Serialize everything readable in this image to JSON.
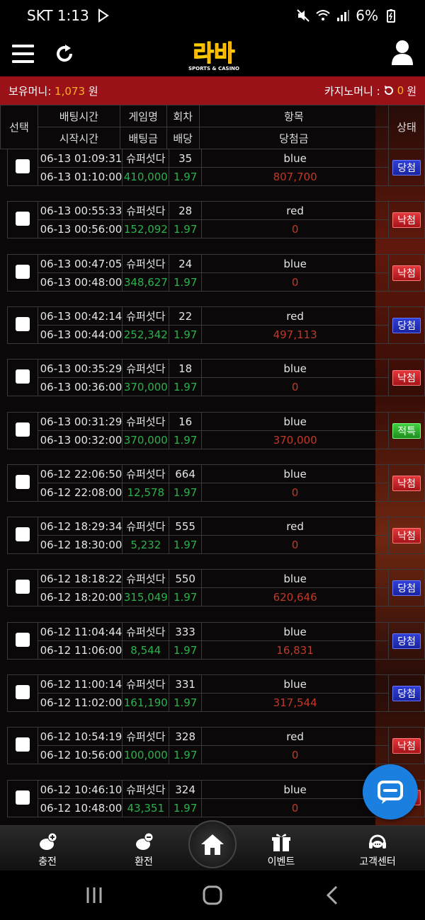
{
  "status_bar": {
    "carrier_time": "SKT 1:13",
    "battery": "6%"
  },
  "header": {
    "logo_text": "라바",
    "logo_sub": "SPORTS & CASINO"
  },
  "balance": {
    "label": "보유머니:",
    "value": "1,073",
    "unit": "원",
    "casino_label": "카지노머니 :",
    "casino_value": "0",
    "casino_unit": "원"
  },
  "table": {
    "headers": {
      "select": "선택",
      "bet_time": "배팅시간",
      "start_time": "시작시간",
      "game": "게임명",
      "bet_amount": "배팅금",
      "round": "회차",
      "odds": "배당",
      "item": "항목",
      "payout": "당첨금",
      "status": "상태"
    },
    "rows": [
      {
        "bet_time": "06-13 01:09:31",
        "start_time": "06-13 01:10:00",
        "game": "슈퍼섯다",
        "amount": "410,000",
        "round": "35",
        "odds": "1.97",
        "item": "blue",
        "payout": "807,700",
        "status": "당첨",
        "status_type": "win"
      },
      {
        "bet_time": "06-13 00:55:33",
        "start_time": "06-13 00:56:00",
        "game": "슈퍼섯다",
        "amount": "152,092",
        "round": "28",
        "odds": "1.97",
        "item": "red",
        "payout": "0",
        "status": "낙첨",
        "status_type": "lose"
      },
      {
        "bet_time": "06-13 00:47:05",
        "start_time": "06-13 00:48:00",
        "game": "슈퍼섯다",
        "amount": "348,627",
        "round": "24",
        "odds": "1.97",
        "item": "blue",
        "payout": "0",
        "status": "낙첨",
        "status_type": "lose"
      },
      {
        "bet_time": "06-13 00:42:14",
        "start_time": "06-13 00:44:00",
        "game": "슈퍼섯다",
        "amount": "252,342",
        "round": "22",
        "odds": "1.97",
        "item": "red",
        "payout": "497,113",
        "status": "당첨",
        "status_type": "win"
      },
      {
        "bet_time": "06-13 00:35:29",
        "start_time": "06-13 00:36:00",
        "game": "슈퍼섯다",
        "amount": "370,000",
        "round": "18",
        "odds": "1.97",
        "item": "blue",
        "payout": "0",
        "status": "낙첨",
        "status_type": "lose"
      },
      {
        "bet_time": "06-13 00:31:29",
        "start_time": "06-13 00:32:00",
        "game": "슈퍼섯다",
        "amount": "370,000",
        "round": "16",
        "odds": "1.97",
        "item": "blue",
        "payout": "370,000",
        "status": "적특",
        "status_type": "refund"
      },
      {
        "bet_time": "06-12 22:06:50",
        "start_time": "06-12 22:08:00",
        "game": "슈퍼섯다",
        "amount": "12,578",
        "round": "664",
        "odds": "1.97",
        "item": "blue",
        "payout": "0",
        "status": "낙첨",
        "status_type": "lose"
      },
      {
        "bet_time": "06-12 18:29:34",
        "start_time": "06-12 18:30:00",
        "game": "슈퍼섯다",
        "amount": "5,232",
        "round": "555",
        "odds": "1.97",
        "item": "red",
        "payout": "0",
        "status": "낙첨",
        "status_type": "lose"
      },
      {
        "bet_time": "06-12 18:18:22",
        "start_time": "06-12 18:20:00",
        "game": "슈퍼섯다",
        "amount": "315,049",
        "round": "550",
        "odds": "1.97",
        "item": "blue",
        "payout": "620,646",
        "status": "당첨",
        "status_type": "win"
      },
      {
        "bet_time": "06-12 11:04:44",
        "start_time": "06-12 11:06:00",
        "game": "슈퍼섯다",
        "amount": "8,544",
        "round": "333",
        "odds": "1.97",
        "item": "blue",
        "payout": "16,831",
        "status": "당첨",
        "status_type": "win"
      },
      {
        "bet_time": "06-12 11:00:14",
        "start_time": "06-12 11:02:00",
        "game": "슈퍼섯다",
        "amount": "161,190",
        "round": "331",
        "odds": "1.97",
        "item": "blue",
        "payout": "317,544",
        "status": "당첨",
        "status_type": "win"
      },
      {
        "bet_time": "06-12 10:54:19",
        "start_time": "06-12 10:56:00",
        "game": "슈퍼섯다",
        "amount": "100,000",
        "round": "328",
        "odds": "1.97",
        "item": "red",
        "payout": "0",
        "status": "낙첨",
        "status_type": "lose"
      },
      {
        "bet_time": "06-12 10:46:10",
        "start_time": "06-12 10:48:00",
        "game": "슈퍼섯다",
        "amount": "43,351",
        "round": "324",
        "odds": "1.97",
        "item": "blue",
        "payout": "0",
        "status": "",
        "status_type": "lose"
      }
    ]
  },
  "bottom_nav": {
    "charge": "충전",
    "exchange": "환전",
    "event": "이벤트",
    "support": "고객센터"
  },
  "colors": {
    "accent_red": "#9a1118",
    "amount_green": "#2bb24c",
    "payout_red": "#c0392b",
    "win_blue": "#2f3fd6",
    "lose_red": "#e4373b",
    "refund_green": "#3fcf3f",
    "chat_blue": "#1b7fe0"
  }
}
